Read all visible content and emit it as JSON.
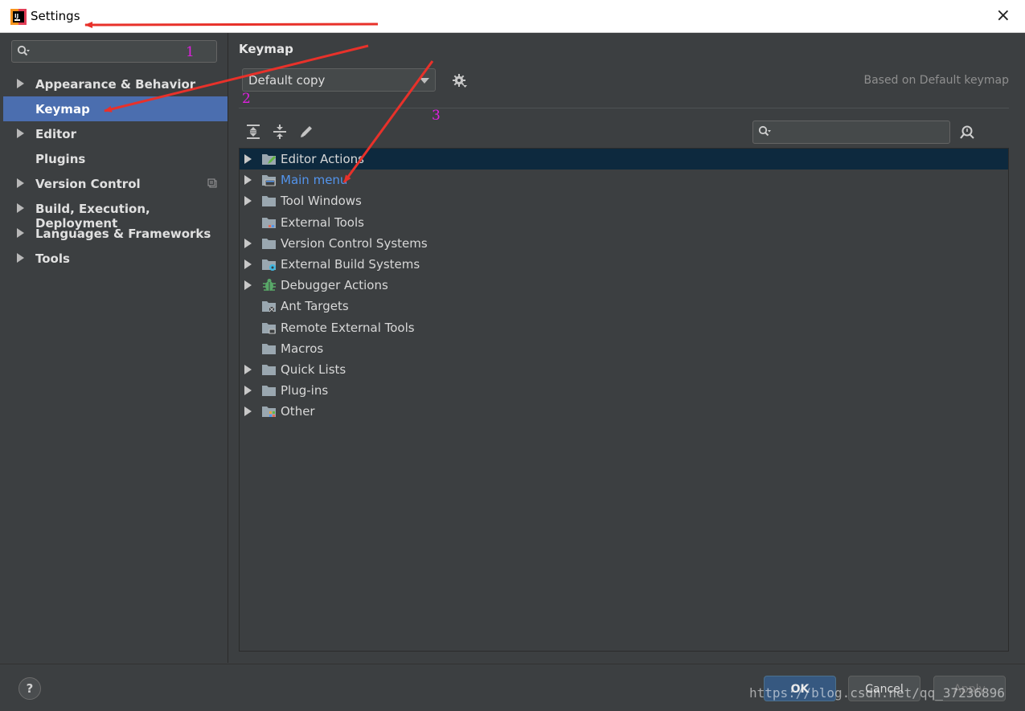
{
  "window": {
    "title": "Settings",
    "close_label": "×"
  },
  "sidebar": {
    "search_placeholder": "",
    "items": [
      {
        "label": "Appearance & Behavior",
        "expandable": true
      },
      {
        "label": "Keymap",
        "expandable": false,
        "selected": true
      },
      {
        "label": "Editor",
        "expandable": true
      },
      {
        "label": "Plugins",
        "expandable": false
      },
      {
        "label": "Version Control",
        "expandable": true,
        "project_icon": true
      },
      {
        "label": "Build, Execution, Deployment",
        "expandable": true
      },
      {
        "label": "Languages & Frameworks",
        "expandable": true
      },
      {
        "label": "Tools",
        "expandable": true
      }
    ]
  },
  "main": {
    "title": "Keymap",
    "keymap_select": "Default copy",
    "based_on": "Based on Default keymap",
    "search_placeholder": "",
    "tree": [
      {
        "label": "Editor Actions",
        "icon": "editor-actions-icon",
        "expandable": true,
        "selected": true
      },
      {
        "label": "Main menu",
        "icon": "main-menu-icon",
        "expandable": true,
        "link": true
      },
      {
        "label": "Tool Windows",
        "icon": "folder-icon",
        "expandable": true
      },
      {
        "label": "External Tools",
        "icon": "external-tools-icon",
        "expandable": false
      },
      {
        "label": "Version Control Systems",
        "icon": "folder-icon",
        "expandable": true
      },
      {
        "label": "External Build Systems",
        "icon": "external-build-icon",
        "expandable": true
      },
      {
        "label": "Debugger Actions",
        "icon": "bug-icon",
        "expandable": true
      },
      {
        "label": "Ant Targets",
        "icon": "ant-targets-icon",
        "expandable": false
      },
      {
        "label": "Remote External Tools",
        "icon": "remote-tools-icon",
        "expandable": false
      },
      {
        "label": "Macros",
        "icon": "folder-icon",
        "expandable": false
      },
      {
        "label": "Quick Lists",
        "icon": "folder-icon",
        "expandable": true
      },
      {
        "label": "Plug-ins",
        "icon": "folder-icon",
        "expandable": true
      },
      {
        "label": "Other",
        "icon": "other-icon",
        "expandable": true
      }
    ]
  },
  "footer": {
    "help_label": "?",
    "ok_label": "OK",
    "cancel_label": "Cancel",
    "apply_label": "Apply"
  },
  "annotations": {
    "numbers": [
      "1",
      "2",
      "3"
    ],
    "arrow_color": "#e8312a",
    "number_color": "#e020e0"
  },
  "watermark": "https://blog.csdn.net/qq_37236896",
  "colors": {
    "selection": "#4b6eaf",
    "tree_selection": "#0d293e",
    "link": "#5394ec",
    "background": "#3c3f41"
  }
}
